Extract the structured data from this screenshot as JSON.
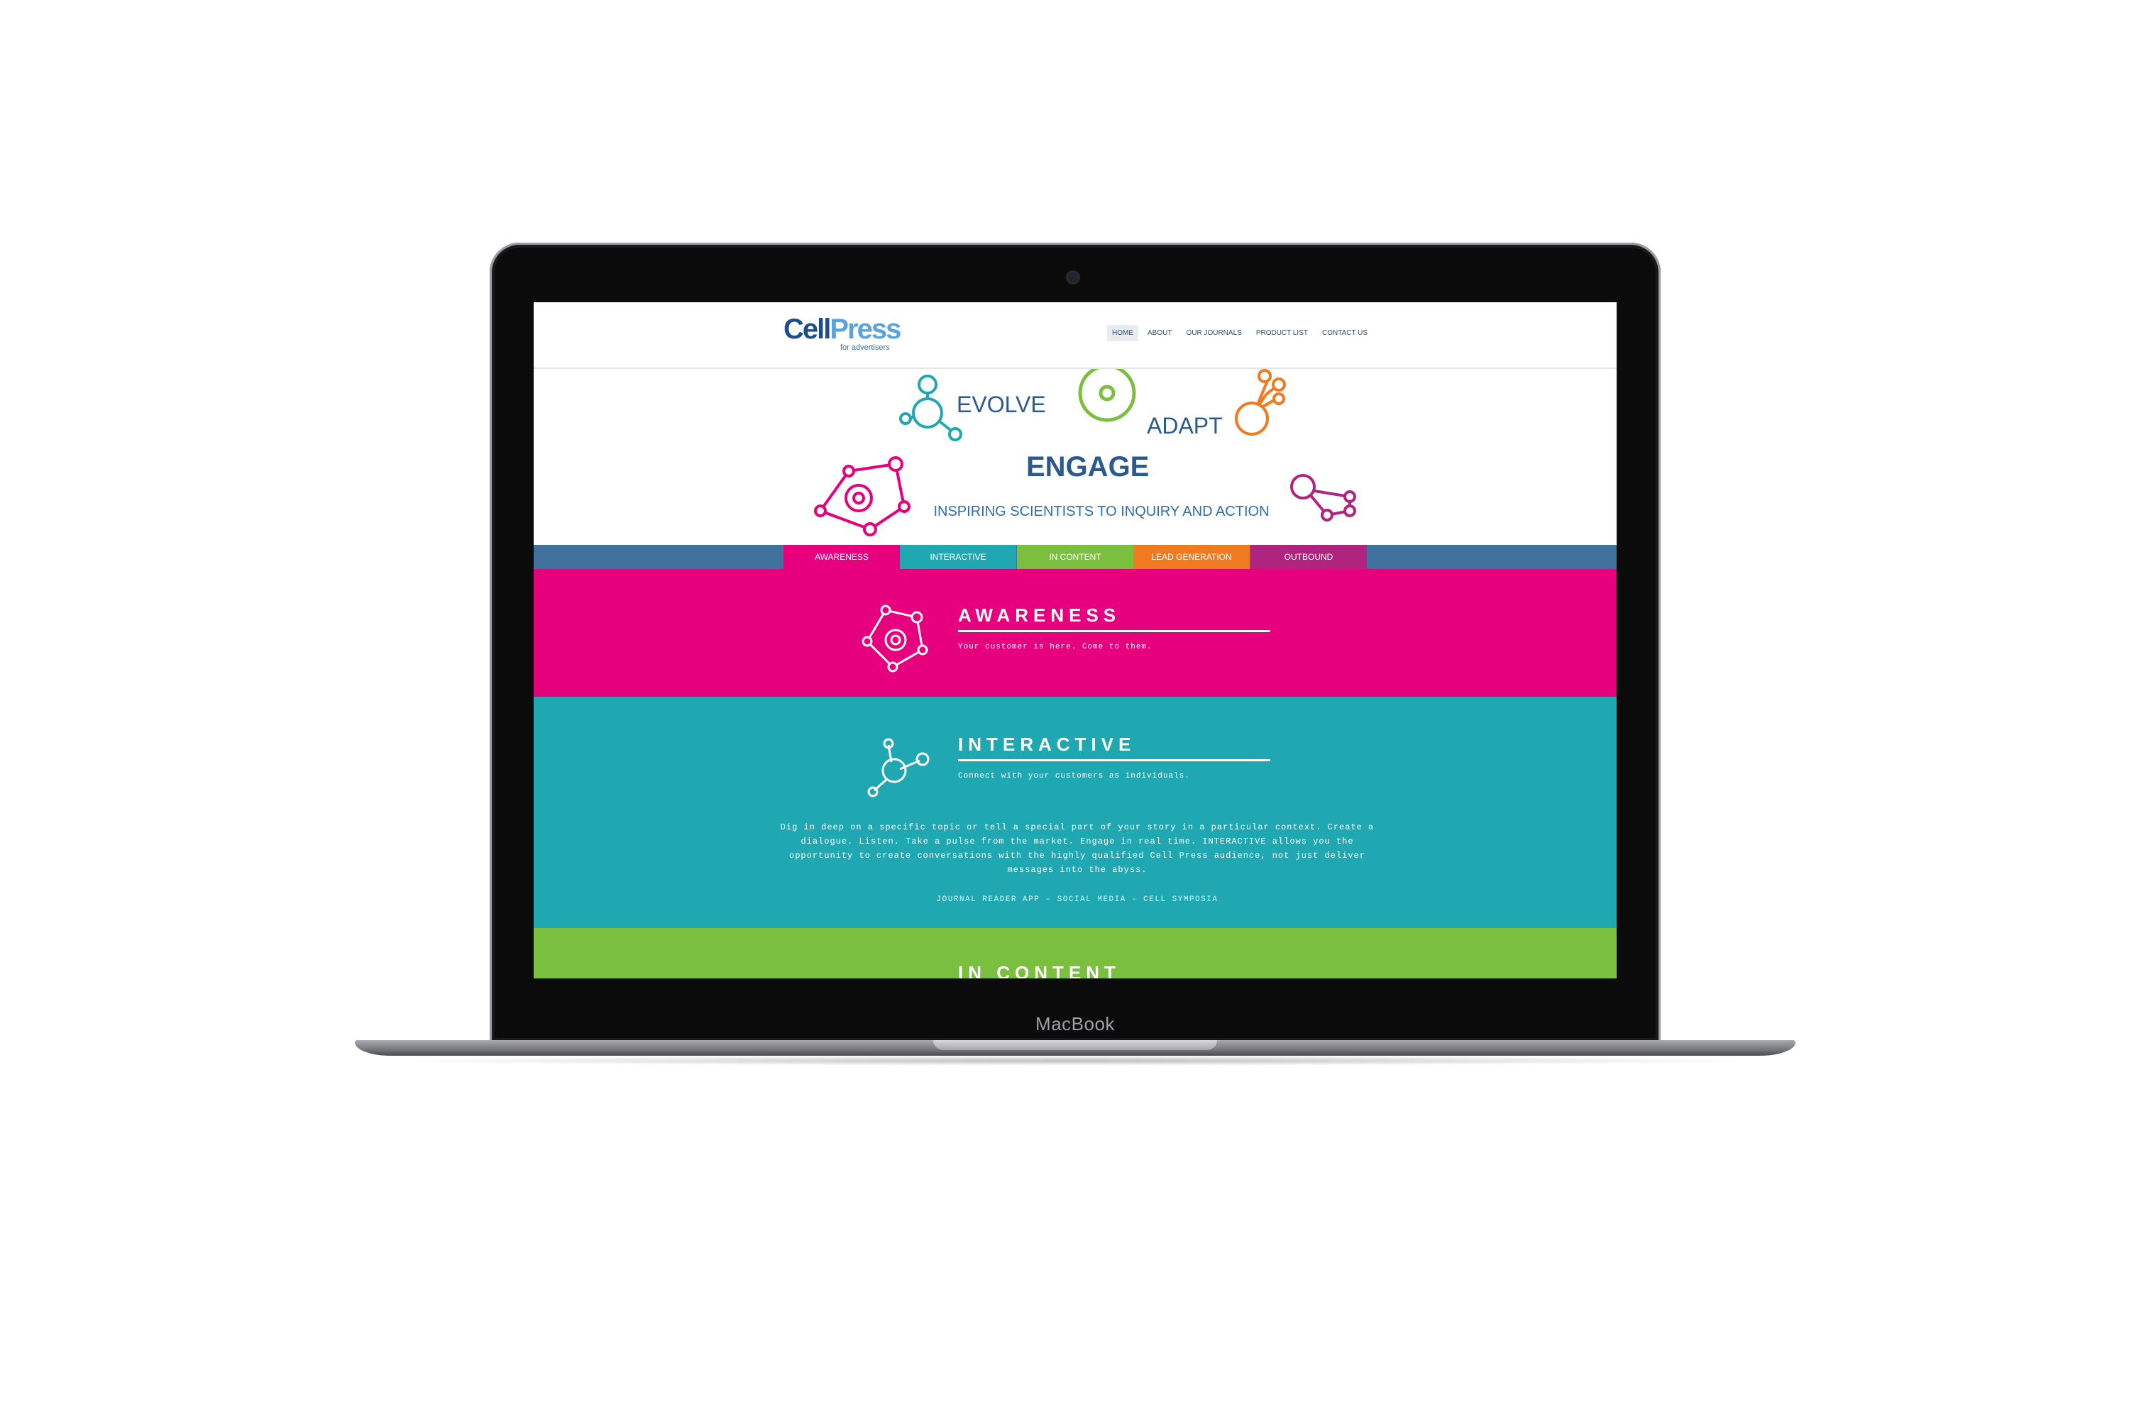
{
  "device": {
    "label": "MacBook"
  },
  "header": {
    "logo": {
      "cell": "Cell",
      "press": "Press",
      "subtitle": "for advertisers"
    },
    "nav": [
      "HOME",
      "ABOUT",
      "OUR JOURNALS",
      "PRODUCT LIST",
      "CONTACT US"
    ],
    "active_nav": "HOME"
  },
  "hero": {
    "words": {
      "evolve": "EVOLVE",
      "adapt": "ADAPT",
      "engage": "ENGAGE"
    },
    "tagline": "INSPIRING SCIENTISTS TO INQUIRY AND ACTION"
  },
  "tabs": [
    "AWARENESS",
    "INTERACTIVE",
    "IN CONTENT",
    "LEAD GENERATION",
    "OUTBOUND"
  ],
  "sections": {
    "awareness": {
      "title": "AWARENESS",
      "subtitle": "Your customer is here. Come to them."
    },
    "interactive": {
      "title": "INTERACTIVE",
      "subtitle": "Connect with your customers as individuals.",
      "body": "Dig in deep on a specific topic or tell a special part of your story in a particular context. Create a dialogue. Listen. Take a pulse from the market. Engage in real time. INTERACTIVE allows you the opportunity to create conversations with the highly qualified Cell Press audience, not just deliver messages into the abyss.",
      "links": "JOURNAL READER APP – SOCIAL MEDIA – CELL SYMPOSIA"
    },
    "in_content": {
      "title": "IN CONTENT"
    }
  },
  "colors": {
    "awareness": "#e6007e",
    "interactive": "#1fa8b2",
    "in_content": "#7bbf3f",
    "lead_generation": "#f07a20",
    "outbound": "#b0237f",
    "nav_bar": "#41729e",
    "brand_blue": "#2b5a8e"
  }
}
